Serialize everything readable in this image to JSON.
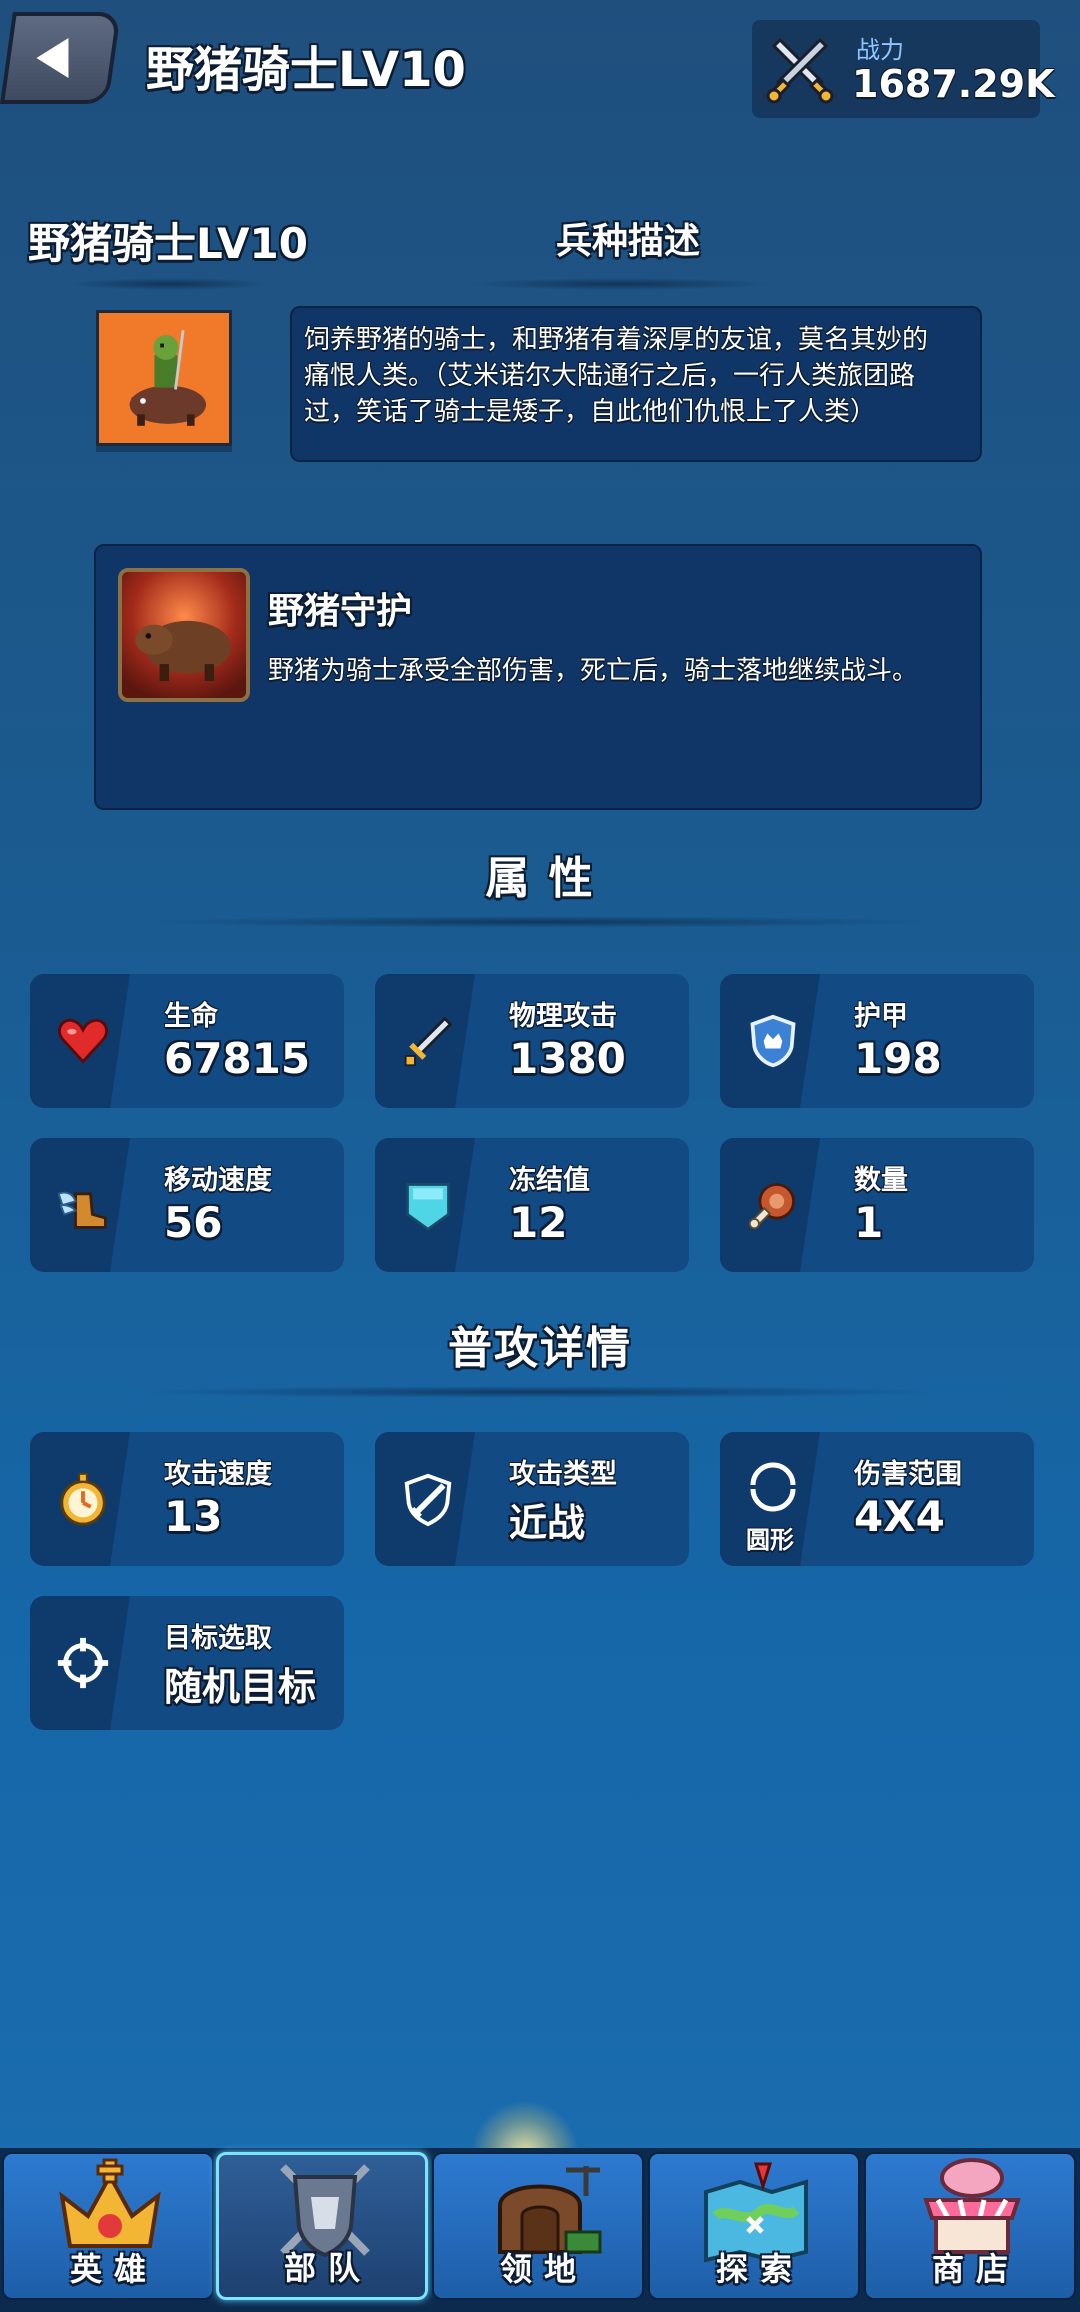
{
  "header": {
    "title": "野猪骑士LV10",
    "power_label": "战力",
    "power_value": "1687.29K"
  },
  "unit": {
    "name": "野猪骑士LV10",
    "description_title": "兵种描述",
    "description_lines": [
      "饲养野猪的骑士，和野猪有着深厚的友谊，莫名其妙的",
      "痛恨人类。（艾米诺尔大陆通行之后，一行人类旅团路",
      "过，笑话了骑士是矮子，自此他们仇恨上了人类）"
    ],
    "portrait_bg": "#f07a2a"
  },
  "skill": {
    "name": "野猪守护",
    "description": "野猪为骑士承受全部伤害，死亡后，骑士落地继续战斗。"
  },
  "attributes": {
    "title": "属  性",
    "items": [
      {
        "label": "生命",
        "value": "67815",
        "icon": "heart-icon"
      },
      {
        "label": "物理攻击",
        "value": "1380",
        "icon": "sword-icon"
      },
      {
        "label": "护甲",
        "value": "198",
        "icon": "shield-icon"
      },
      {
        "label": "移动速度",
        "value": "56",
        "icon": "winged-boot-icon"
      },
      {
        "label": "冻结值",
        "value": "12",
        "icon": "ice-shield-icon"
      },
      {
        "label": "数量",
        "value": "1",
        "icon": "meat-icon"
      }
    ]
  },
  "attack": {
    "title": "普攻详情",
    "items": [
      {
        "label": "攻击速度",
        "value": "13",
        "icon": "stopwatch-icon"
      },
      {
        "label": "攻击类型",
        "value": "近战",
        "icon": "melee-icon"
      },
      {
        "label": "伤害范围",
        "value": "4X4",
        "icon": "circle-range-icon",
        "sub": "圆形"
      },
      {
        "label": "目标选取",
        "value": "随机目标",
        "icon": "target-icon"
      }
    ]
  },
  "nav": {
    "items": [
      {
        "label": "英雄",
        "icon": "crown-hero-icon",
        "active": false
      },
      {
        "label": "部队",
        "icon": "army-shield-icon",
        "active": true
      },
      {
        "label": "领地",
        "icon": "territory-house-icon",
        "active": false
      },
      {
        "label": "探索",
        "icon": "map-explore-icon",
        "active": false
      },
      {
        "label": "商店",
        "icon": "shop-icon",
        "active": false
      }
    ]
  },
  "colors": {
    "background": "#1b5a8e",
    "card": "#124a84",
    "panel": "#0f3667",
    "accent": "#7ce4ff"
  }
}
